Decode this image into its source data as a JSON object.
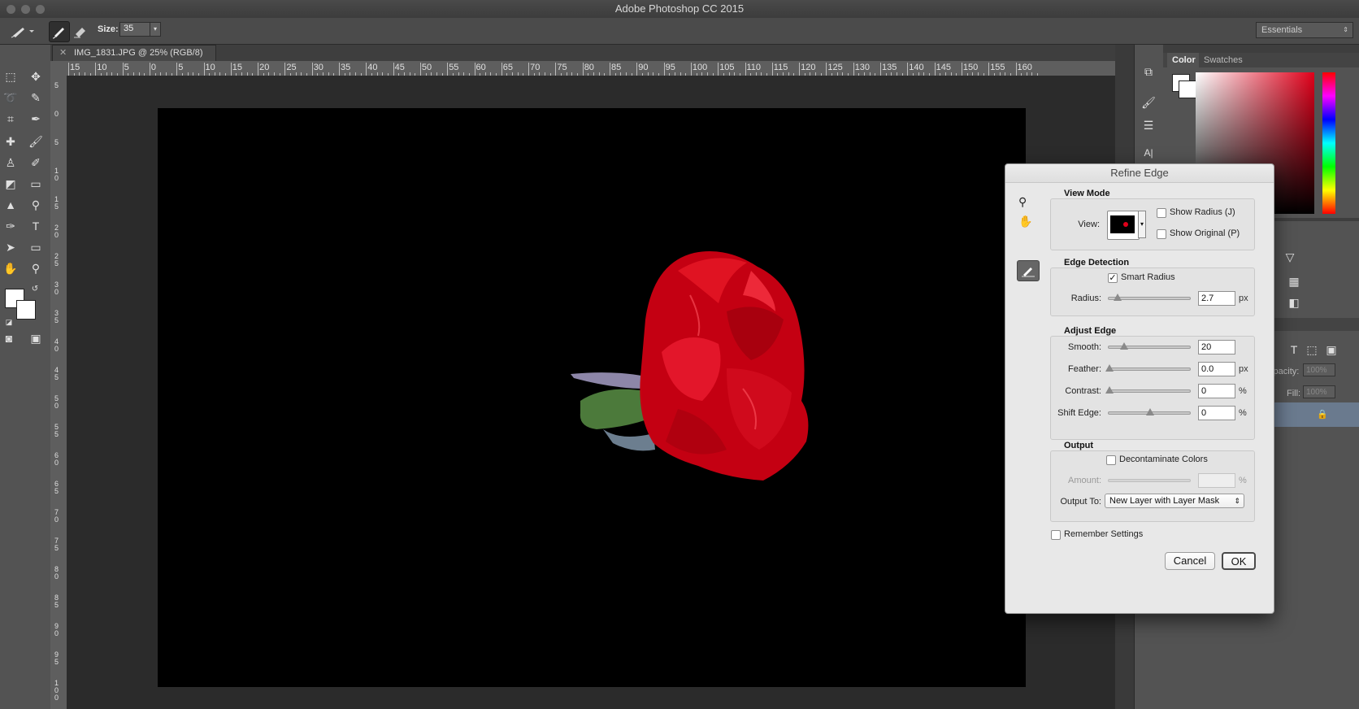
{
  "app": {
    "title": "Adobe Photoshop CC 2015"
  },
  "options_bar": {
    "size_label": "Size:",
    "size_value": "35",
    "workspace": "Essentials"
  },
  "document": {
    "tab_title": "IMG_1831.JPG @ 25% (RGB/8)"
  },
  "rulers": {
    "horizontal": [
      "15",
      "10",
      "5",
      "0",
      "5",
      "10",
      "15",
      "20",
      "25",
      "30",
      "35",
      "40",
      "45",
      "50",
      "55",
      "60",
      "65",
      "70",
      "75",
      "80",
      "85",
      "90",
      "95",
      "100",
      "105",
      "110",
      "115",
      "120",
      "125",
      "130",
      "135",
      "140",
      "145",
      "150",
      "155",
      "160"
    ],
    "vertical": [
      "5",
      "0",
      "5",
      "10",
      "15",
      "20",
      "25",
      "30",
      "35",
      "40",
      "45",
      "50",
      "55",
      "60",
      "65",
      "70",
      "75",
      "80",
      "85",
      "90",
      "95",
      "100"
    ]
  },
  "panels": {
    "color_tab": "Color",
    "swatches_tab": "Swatches",
    "opacity_label": "Opacity:",
    "opacity_value": "100%",
    "fill_label": "Fill:",
    "fill_value": "100%",
    "partial_tab": "hs"
  },
  "refine_edge": {
    "title": "Refine Edge",
    "view_mode": {
      "heading": "View Mode",
      "view_label": "View:",
      "show_radius": "Show Radius (J)",
      "show_original": "Show Original (P)",
      "show_radius_checked": false,
      "show_original_checked": false
    },
    "edge_detection": {
      "heading": "Edge Detection",
      "smart_radius": "Smart Radius",
      "smart_radius_checked": true,
      "radius_label": "Radius:",
      "radius_value": "2.7",
      "radius_unit": "px"
    },
    "adjust_edge": {
      "heading": "Adjust Edge",
      "smooth_label": "Smooth:",
      "smooth_value": "20",
      "feather_label": "Feather:",
      "feather_value": "0.0",
      "feather_unit": "px",
      "contrast_label": "Contrast:",
      "contrast_value": "0",
      "contrast_unit": "%",
      "shift_label": "Shift Edge:",
      "shift_value": "0",
      "shift_unit": "%"
    },
    "output": {
      "heading": "Output",
      "decontaminate": "Decontaminate Colors",
      "decontaminate_checked": false,
      "amount_label": "Amount:",
      "amount_value": "",
      "amount_unit": "%",
      "output_to_label": "Output To:",
      "output_to_value": "New Layer with Layer Mask"
    },
    "remember": "Remember Settings",
    "remember_checked": false,
    "cancel": "Cancel",
    "ok": "OK"
  },
  "colors": {
    "accent": "#e0001a",
    "canvas": "#000000",
    "dialog_bg": "#e8e8e8"
  }
}
